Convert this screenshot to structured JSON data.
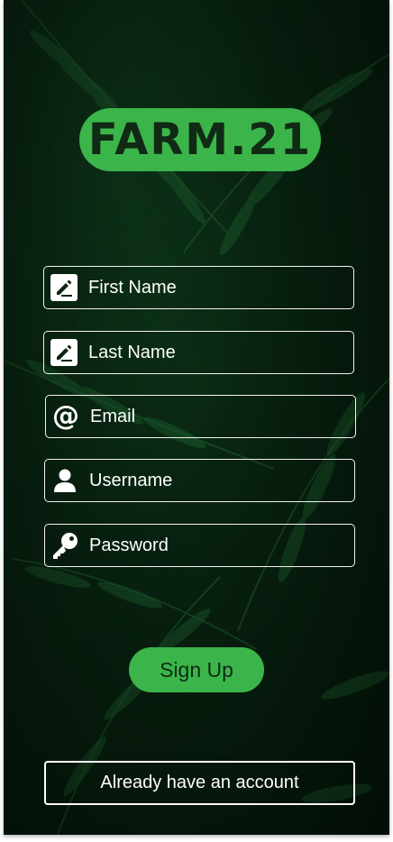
{
  "app": {
    "logo_text": "FARM.21",
    "brand_color": "#3bb54a"
  },
  "form": {
    "fields": [
      {
        "name": "first_name",
        "icon": "edit-square-icon",
        "placeholder": "First Name",
        "value": ""
      },
      {
        "name": "last_name",
        "icon": "edit-square-icon",
        "placeholder": "Last Name",
        "value": ""
      },
      {
        "name": "email",
        "icon": "at-sign-icon",
        "placeholder": "Email",
        "value": ""
      },
      {
        "name": "username",
        "icon": "user-icon",
        "placeholder": "Username",
        "value": ""
      },
      {
        "name": "password",
        "icon": "key-icon",
        "placeholder": "Password",
        "value": ""
      }
    ]
  },
  "actions": {
    "signup_label": "Sign Up",
    "account_label": "Already have an account"
  }
}
